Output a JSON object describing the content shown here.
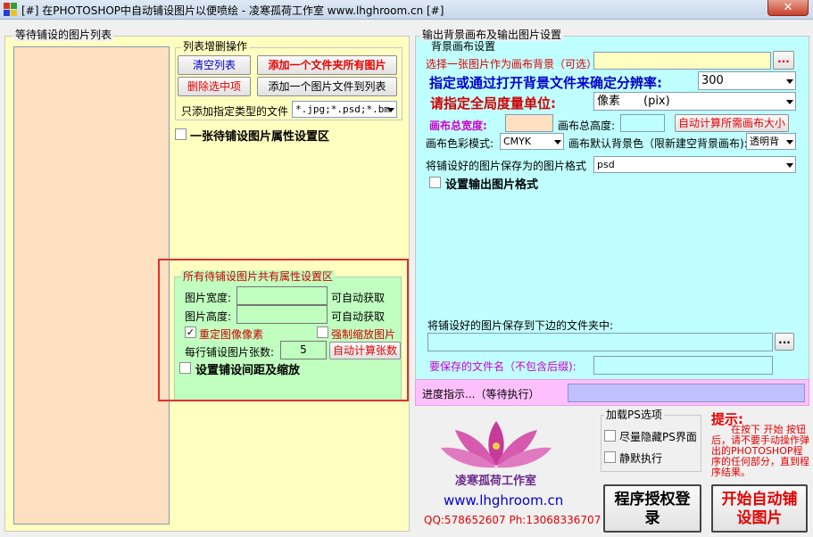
{
  "window": {
    "title": "[#] 在PHOTOSHOP中自动铺设图片以便喷绘 - 凌寒孤荷工作室 www.lhghroom.cn [#]",
    "close_label": "✕"
  },
  "left_panel": {
    "title": "等待铺设的图片列表",
    "list_ops": {
      "title": "列表增删操作",
      "clear_label": "清空列表",
      "add_folder_label": "添加一个文件夹所有图片",
      "delete_selected_label": "删除选中项",
      "add_file_label": "添加一个图片文件到列表",
      "filter_label": "只添加指定类型的文件",
      "filter_value": "*.jpg;*.psd;*.bm"
    },
    "single_props_label": "一张待铺设图片属性设置区",
    "common_props": {
      "title": "所有待铺设图片共有属性设置区",
      "width_label": "图片宽度:",
      "height_label": "图片高度:",
      "auto_get_1": "可自动获取",
      "auto_get_2": "可自动获取",
      "resample_label": "重定图像像素",
      "resample_checked": true,
      "force_scale_label": "强制缩放图片",
      "per_row_label": "每行铺设图片张数:",
      "per_row_value": "5",
      "auto_calc_label": "自动计算张数",
      "spacing_label": "设置铺设间距及缩放"
    }
  },
  "right_panel": {
    "title": "输出背景画布及输出图片设置",
    "canvas_group_title": "背景画布设置",
    "select_bg_label": "选择一张图片作为画布背景（可选）",
    "browse_label": "...",
    "resolution_label": "指定或通过打开背景文件来确定分辨率:",
    "resolution_value": "300",
    "unit_label": "请指定全局度量单位:",
    "unit_value": "像素　　(pix)",
    "total_width_label": "画布总宽度:",
    "total_height_label": "画布总高度:",
    "auto_canvas_label": "自动计算所需画布大小",
    "color_mode_label": "画布色彩模式:",
    "color_mode_value": "CMYK",
    "default_bg_label": "画布默认背景色（限新建空背景画布):",
    "default_bg_value": "透明背",
    "save_format_label": "将铺设好的图片保存为的图片格式",
    "save_format_value": "psd",
    "output_format_label": "设置输出图片格式",
    "save_folder_label": "将铺设好的图片保存到下边的文件夹中:",
    "browse_label_2": "...",
    "filename_label": "要保存的文件名（不包含后缀):",
    "progress_label": "进度指示...（等待执行）"
  },
  "bottom": {
    "brand_name": "凌寒孤荷工作室",
    "website": "www.lhghroom.cn",
    "contact": "QQ:578652607   Ph:13068336707",
    "ps_options_title": "加载PS选项",
    "hide_ps_label": "尽量隐藏PS界面",
    "silent_label": "静默执行",
    "tip_title": "提示:",
    "tip_text": "在按下 开始 按钮后，请不要手动操作弹出的PHOTOSHOP程序的任何部分，直到程序结果。",
    "license_label": "程序授权登录",
    "start_label": "开始自动铺设图片"
  },
  "colors": {
    "left_bg": "#ffffc0",
    "list_bg": "#ffe0c0",
    "common_bg": "#c0ffc0",
    "right_bg": "#c0ffff",
    "progress_bg": "#ffc0ff",
    "progress_bar": "#c0c0ff",
    "accent_red": "#e60000",
    "accent_blue": "#0000cc",
    "highlight_box": "#e03030"
  }
}
